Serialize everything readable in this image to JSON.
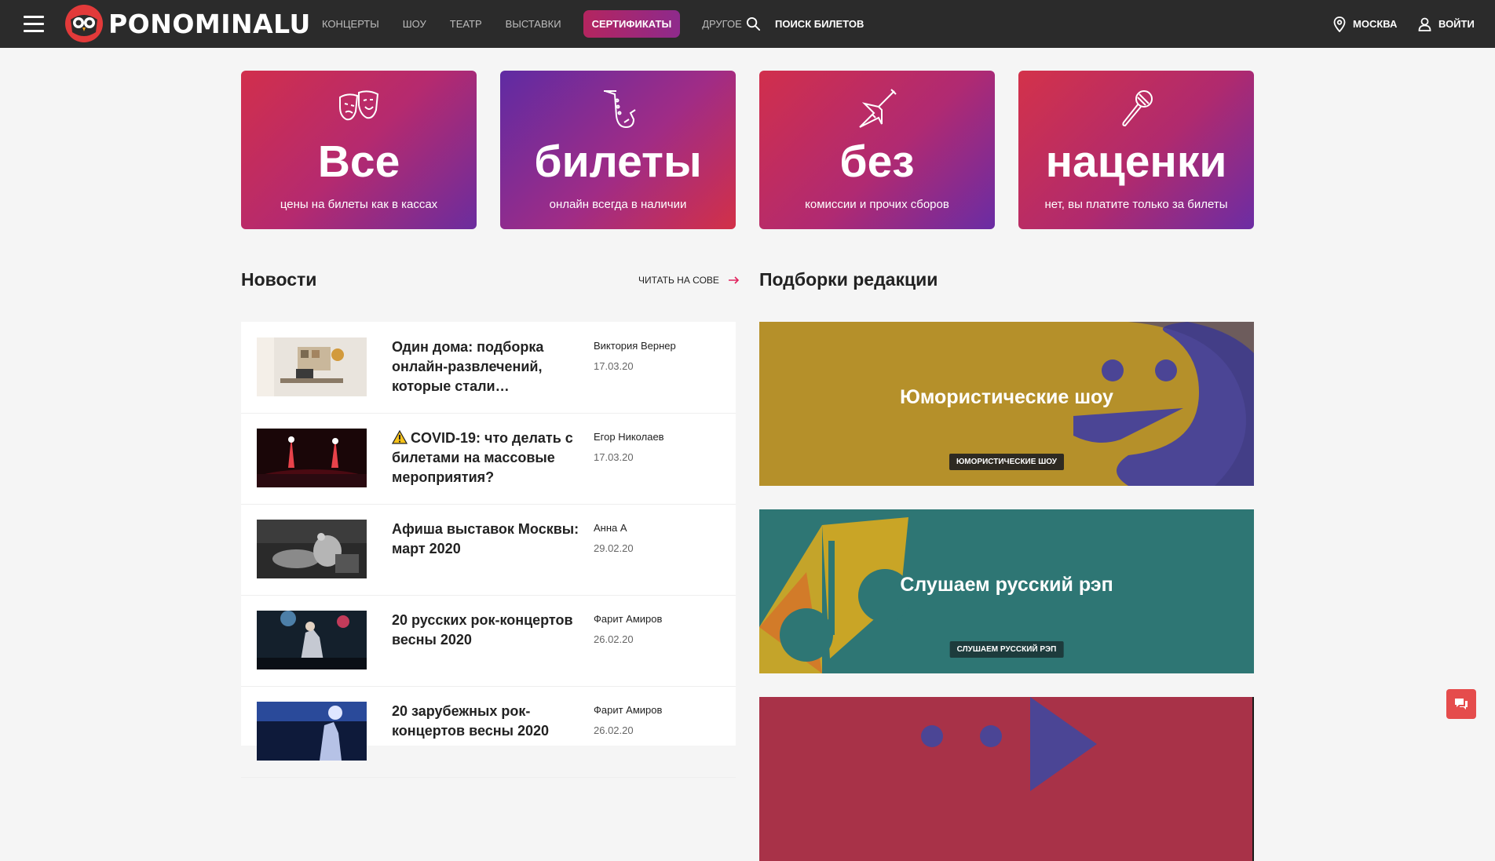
{
  "header": {
    "logo_text": "PONOMINALU",
    "nav": [
      "КОНЦЕРТЫ",
      "ШОУ",
      "ТЕАТР",
      "ВЫСТАВКИ",
      "СЕРТИФИКАТЫ",
      "ДРУГОЕ"
    ],
    "active_nav": "СЕРТИФИКАТЫ",
    "search_label": "ПОИСК БИЛЕТОВ",
    "city": "МОСКВА",
    "login": "ВОЙТИ"
  },
  "promo": [
    {
      "icon": "theater-masks-icon",
      "big": "Все",
      "small": "цены на билеты как в кассах"
    },
    {
      "icon": "saxophone-icon",
      "big": "билеты",
      "small": "онлайн всегда в наличии"
    },
    {
      "icon": "guitar-icon",
      "big": "без",
      "small": "комиссии и прочих сборов"
    },
    {
      "icon": "microphone-icon",
      "big": "наценки",
      "small": "нет, вы платите только за билеты"
    }
  ],
  "news": {
    "title": "Новости",
    "read_more": "ЧИТАТЬ НА СОВЕ",
    "items": [
      {
        "title": "Один дома: подборка онлайн-развлечений, которые стали…",
        "author": "Виктория Вернер",
        "date": "17.03.20"
      },
      {
        "title": "COVID-19: что делать с билетами на массовые мероприятия?",
        "author": "Егор Николаев",
        "date": "17.03.20",
        "warning": true
      },
      {
        "title": "Афиша выставок Москвы: март 2020",
        "author": "Анна А",
        "date": "29.02.20"
      },
      {
        "title": "20 русских рок-концертов весны 2020",
        "author": "Фарит Амиров",
        "date": "26.02.20"
      },
      {
        "title": "20 зарубежных рок-концертов весны 2020",
        "author": "Фарит Амиров",
        "date": "26.02.20"
      }
    ]
  },
  "collections": {
    "title": "Подборки редакции",
    "items": [
      {
        "title": "Юмористические шоу",
        "tag": "ЮМОРИСТИЧЕСКИЕ ШОУ",
        "color": "#b5902a"
      },
      {
        "title": "Слушаем русский рэп",
        "tag": "СЛУШАЕМ РУССКИЙ РЭП",
        "color": "#2e7674"
      },
      {
        "title": "",
        "tag": "",
        "color": "#a83248"
      }
    ]
  },
  "colors": {
    "header_bg": "#2b2b2b",
    "accent": "#b4255f",
    "chat": "#e54c4c"
  }
}
